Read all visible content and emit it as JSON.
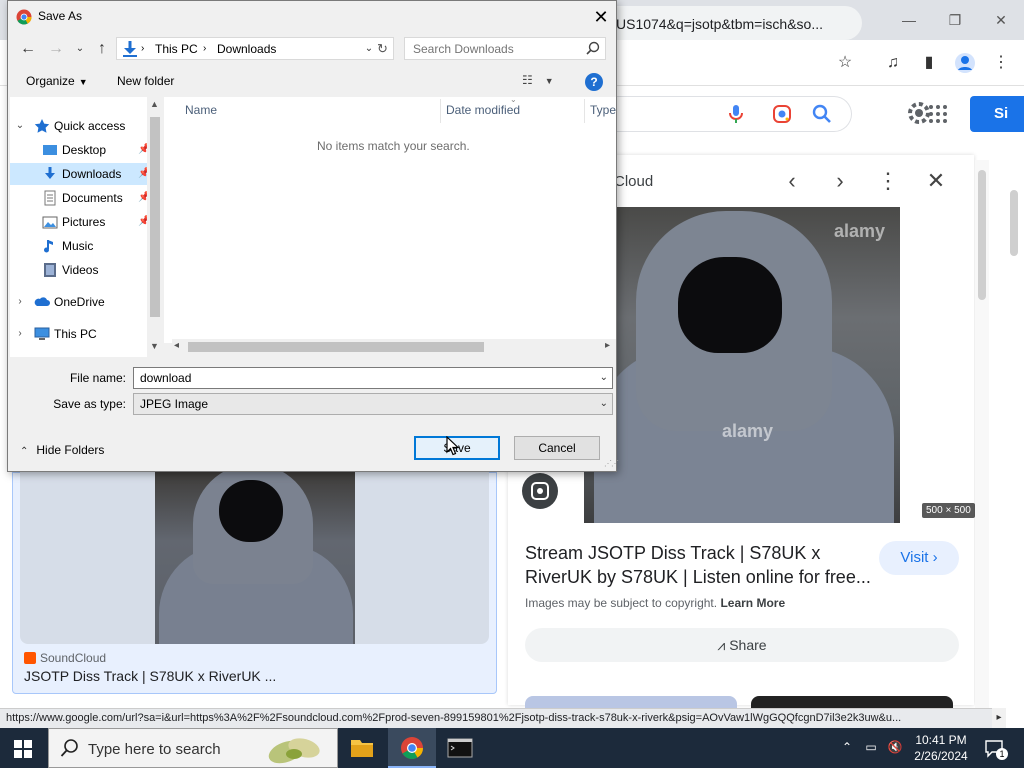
{
  "browser": {
    "omnibox_text": "US1074&q=jsotp&tbm=isch&so...",
    "signin_label": "Si",
    "side_panel": {
      "source_title": "Cloud",
      "size_badge": "500 × 500",
      "watermark": "alamy",
      "headline": "Stream JSOTP Diss Track | S78UK x RiverUK by S78UK | Listen online for free...",
      "visit_label": "Visit ›",
      "copyright_text": "Images may be subject to copyright.",
      "learn_more": "Learn More",
      "share_label": "Share"
    },
    "left_card": {
      "source": "SoundCloud",
      "title": "JSOTP Diss Track | S78UK x RiverUK ..."
    },
    "status_url": "https://www.google.com/url?sa=i&url=https%3A%2F%2Fsoundcloud.com%2Fprod-seven-899159801%2Fjsotp-diss-track-s78uk-x-riverk&psig=AOvVaw1lWgGQQfcgnD7il3e2k3uw&u..."
  },
  "dialog": {
    "title": "Save As",
    "breadcrumb": [
      "This PC",
      "Downloads"
    ],
    "search_placeholder": "Search Downloads",
    "toolbar": {
      "organize": "Organize",
      "new_folder": "New folder"
    },
    "columns": {
      "name": "Name",
      "date": "Date modified",
      "type": "Type"
    },
    "empty_message": "No items match your search.",
    "nav": {
      "quick_access": "Quick access",
      "items": [
        "Desktop",
        "Downloads",
        "Documents",
        "Pictures",
        "Music",
        "Videos"
      ],
      "onedrive": "OneDrive",
      "this_pc": "This PC"
    },
    "file_name_label": "File name:",
    "file_name_value": "download",
    "save_type_label": "Save as type:",
    "save_type_value": "JPEG Image",
    "hide_folders": "Hide Folders",
    "save_label": "Save",
    "cancel_label": "Cancel"
  },
  "taskbar": {
    "search_placeholder": "Type here to search",
    "time": "10:41 PM",
    "date": "2/26/2024",
    "notification_count": "1"
  },
  "colors": {
    "accent": "#0078d7",
    "google_blue": "#1a73e8",
    "taskbar": "#1c2a3b"
  }
}
